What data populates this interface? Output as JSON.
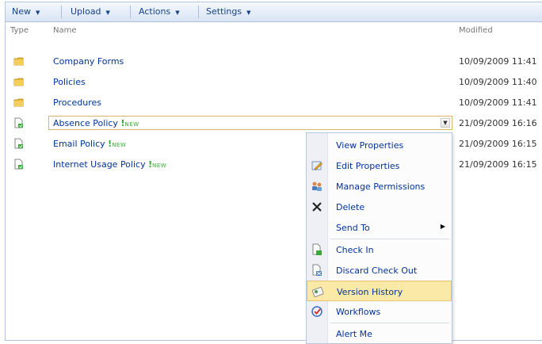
{
  "toolbar": {
    "new_label": "New",
    "upload_label": "Upload",
    "actions_label": "Actions",
    "settings_label": "Settings",
    "arrow_glyph": "▼"
  },
  "header": {
    "type": "Type",
    "name": "Name",
    "modified": "Modified"
  },
  "folders": [
    {
      "name": "Company Forms",
      "modified": "10/09/2009 11:41"
    },
    {
      "name": "Policies",
      "modified": "10/09/2009 11:40"
    },
    {
      "name": "Procedures",
      "modified": "10/09/2009 11:41"
    }
  ],
  "documents": [
    {
      "name": "Absence Policy",
      "modified": "21/09/2009 16:16"
    },
    {
      "name": "Email Policy",
      "modified": "21/09/2009 16:15"
    },
    {
      "name": "Internet Usage Policy",
      "modified": "21/09/2009 16:15"
    }
  ],
  "new_badge": {
    "mark": "!",
    "text": "NEW"
  },
  "dropdown_glyph": "▼",
  "menu": {
    "view_properties": "View Properties",
    "edit_properties": "Edit Properties",
    "manage_permissions": "Manage Permissions",
    "delete": "Delete",
    "send_to": "Send To",
    "check_in": "Check In",
    "discard_check_out": "Discard Check Out",
    "version_history": "Version History",
    "workflows": "Workflows",
    "alert_me": "Alert Me",
    "submenu_glyph": "▶"
  },
  "colors": {
    "link": "#003399",
    "highlight": "#fbe9a8",
    "new_badge": "#33aa33",
    "folder": "#e9b83a"
  }
}
